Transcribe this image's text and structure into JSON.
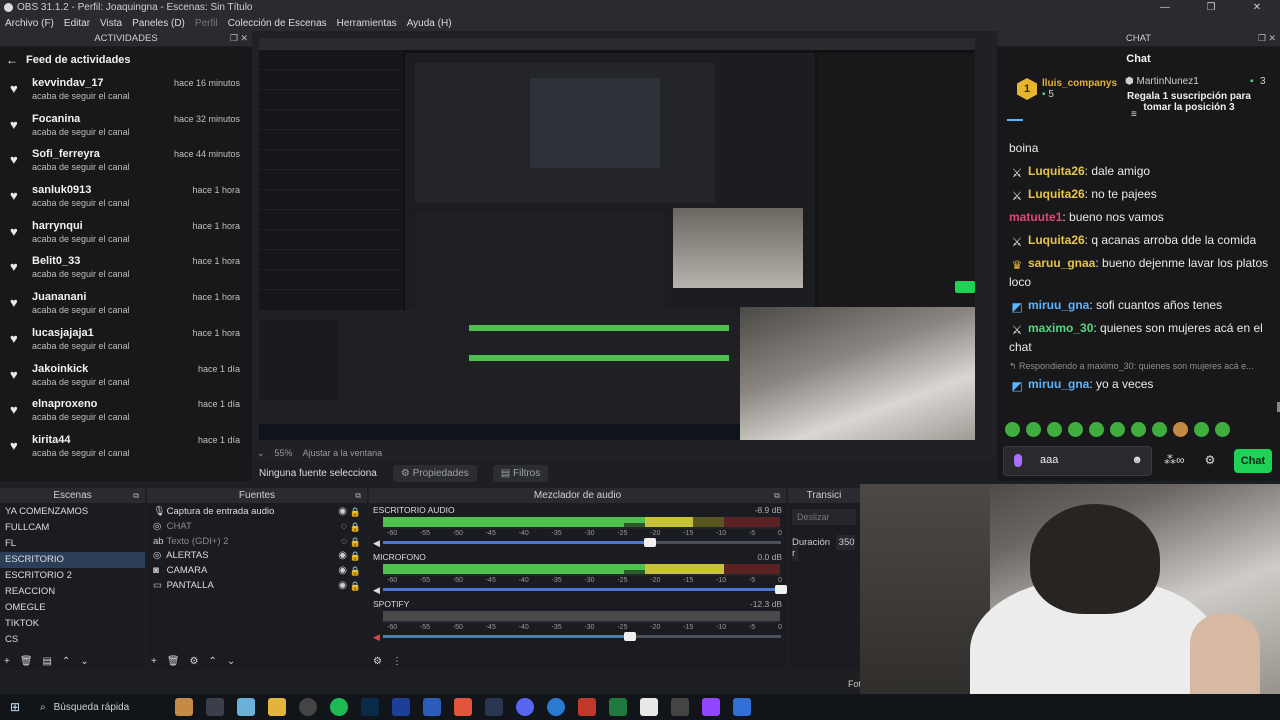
{
  "window": {
    "title": "OBS 31.1.2 - Perfil: Joaquingna - Escenas: Sin Título",
    "controls": [
      "—",
      "❐",
      "✕"
    ]
  },
  "menu": [
    {
      "label": "Archivo (F)",
      "disabled": false
    },
    {
      "label": "Editar",
      "disabled": false
    },
    {
      "label": "Vista",
      "disabled": false
    },
    {
      "label": "Paneles (D)",
      "disabled": false
    },
    {
      "label": "Perfil",
      "disabled": true
    },
    {
      "label": "Colección de Escenas",
      "disabled": false
    },
    {
      "label": "Herramientas",
      "disabled": false
    },
    {
      "label": "Ayuda (H)",
      "disabled": false
    }
  ],
  "activity_dock": {
    "header": "ACTIVIDADES",
    "title": "Feed de actividades",
    "items": [
      {
        "user": "kevvindav_17",
        "time": "hace 16 minutos",
        "action": "acaba de seguir el canal"
      },
      {
        "user": "Focanina",
        "time": "hace 32 minutos",
        "action": "acaba de seguir el canal"
      },
      {
        "user": "Sofi_ferreyra",
        "time": "hace 44 minutos",
        "action": "acaba de seguir el canal"
      },
      {
        "user": "sanluk0913",
        "time": "hace 1 hora",
        "action": "acaba de seguir el canal"
      },
      {
        "user": "harrynqui",
        "time": "hace 1 hora",
        "action": "acaba de seguir el canal"
      },
      {
        "user": "Belit0_33",
        "time": "hace 1 hora",
        "action": "acaba de seguir el canal"
      },
      {
        "user": "Juananani",
        "time": "hace 1 hora",
        "action": "acaba de seguir el canal"
      },
      {
        "user": "lucasjajaja1",
        "time": "hace 1 hora",
        "action": "acaba de seguir el canal"
      },
      {
        "user": "Jakoinkick",
        "time": "hace 1 día",
        "action": "acaba de seguir el canal"
      },
      {
        "user": "elnaproxeno",
        "time": "hace 1 día",
        "action": "acaba de seguir el canal"
      },
      {
        "user": "kirita44",
        "time": "hace 1 día",
        "action": "acaba de seguir el canal"
      }
    ]
  },
  "chat_dock": {
    "header": "CHAT",
    "title": "Chat",
    "pinned": {
      "left_user": "lluis_companys",
      "left_rank": "1",
      "left_count": "5",
      "right_user": "MartinNunez1",
      "right_count": "3",
      "message": "Regala 1 suscripción para tomar la posición 3"
    },
    "messages": [
      {
        "nick": "",
        "text": "boina",
        "color": "#eaeaea",
        "badge": ""
      },
      {
        "nick": "Luquita26",
        "text": "dale amigo",
        "color": "#e8c547",
        "badge": "sword-icon"
      },
      {
        "nick": "Luquita26",
        "text": "no te pajees",
        "color": "#e8c547",
        "badge": "sword-icon"
      },
      {
        "nick": "matuute1",
        "text": "bueno nos vamos",
        "color": "#e0457b",
        "badge": ""
      },
      {
        "nick": "Luquita26",
        "text": "q acanas arroba dde la comida",
        "color": "#e8c547",
        "badge": "sword-icon"
      },
      {
        "nick": "saruu_gnaa",
        "text": "bueno dejenme lavar los platos loco",
        "color": "#e8c547",
        "badge": "crown-icon"
      },
      {
        "nick": "miruu_gna",
        "text": "sofi cuantos años tenes",
        "color": "#5ab4ff",
        "badge": "prime-icon"
      },
      {
        "nick": "maximo_30",
        "text": "quienes son mujeres acá en el chat",
        "color": "#4fd87a",
        "badge": "sword-icon"
      }
    ],
    "reply_hint": "↰ Respondiendo a maximo_30: quienes son mujeres acá e...",
    "last_message": {
      "nick": "miruu_gna",
      "text": "yo a veces",
      "color": "#5ab4ff",
      "badge": "prime-icon"
    },
    "input_value": "aaa",
    "send_label": "Chat"
  },
  "preview": {
    "zoom": "55%",
    "fit_label": "Ajustar a la ventana",
    "selection": "Ninguna fuente selecciona",
    "properties": "Propiedades",
    "filters": "Filtros"
  },
  "scenes": {
    "header": "Escenas",
    "items": [
      "YA COMENZAMOS",
      "FULLCAM",
      "FL",
      "ESCRITORIO",
      "ESCRITORIO 2",
      "REACCION",
      "OMEGLE",
      "TIKTOK",
      "CS"
    ],
    "active_index": 3
  },
  "sources": {
    "header": "Fuentes",
    "items": [
      {
        "name": "Captura de entrada audio",
        "icon": "mic-icon",
        "visible": true
      },
      {
        "name": "CHAT",
        "icon": "globe-icon",
        "visible": false
      },
      {
        "name": "Texto (GDI+) 2",
        "icon": "text-icon",
        "visible": false
      },
      {
        "name": "ALERTAS",
        "icon": "globe-icon",
        "visible": true
      },
      {
        "name": "CAMARA",
        "icon": "camera-icon",
        "visible": true
      },
      {
        "name": "PANTALLA",
        "icon": "monitor-icon",
        "visible": true
      }
    ]
  },
  "mixer": {
    "header": "Mezclador de audio",
    "ticks": [
      "-60",
      "-55",
      "-50",
      "-45",
      "-40",
      "-35",
      "-30",
      "-25",
      "-20",
      "-15",
      "-10",
      "-5",
      "0"
    ],
    "channels": [
      {
        "name": "ESCRITORIO AUDIO",
        "db": "-8.9 dB",
        "level": 0.78,
        "volume": 0.67,
        "muted": false
      },
      {
        "name": "MICROFONO",
        "db": "0.0 dB",
        "level": 0.86,
        "volume": 1.0,
        "muted": false
      },
      {
        "name": "SPOTIFY",
        "db": "-12.3 dB",
        "level": 0.0,
        "volume": 0.62,
        "muted": true
      }
    ]
  },
  "transitions": {
    "header": "Transici",
    "fade": "Deslizar",
    "duration_label": "Duración",
    "duration_value": "350 r"
  },
  "status": {
    "fo": "Fot"
  },
  "taskbar": {
    "search_placeholder": "Búsqueda rápida"
  },
  "colors": {
    "accent_green": "#1fd155",
    "twitch_purple": "#a970ff",
    "scene_active": "#2c3f59"
  }
}
